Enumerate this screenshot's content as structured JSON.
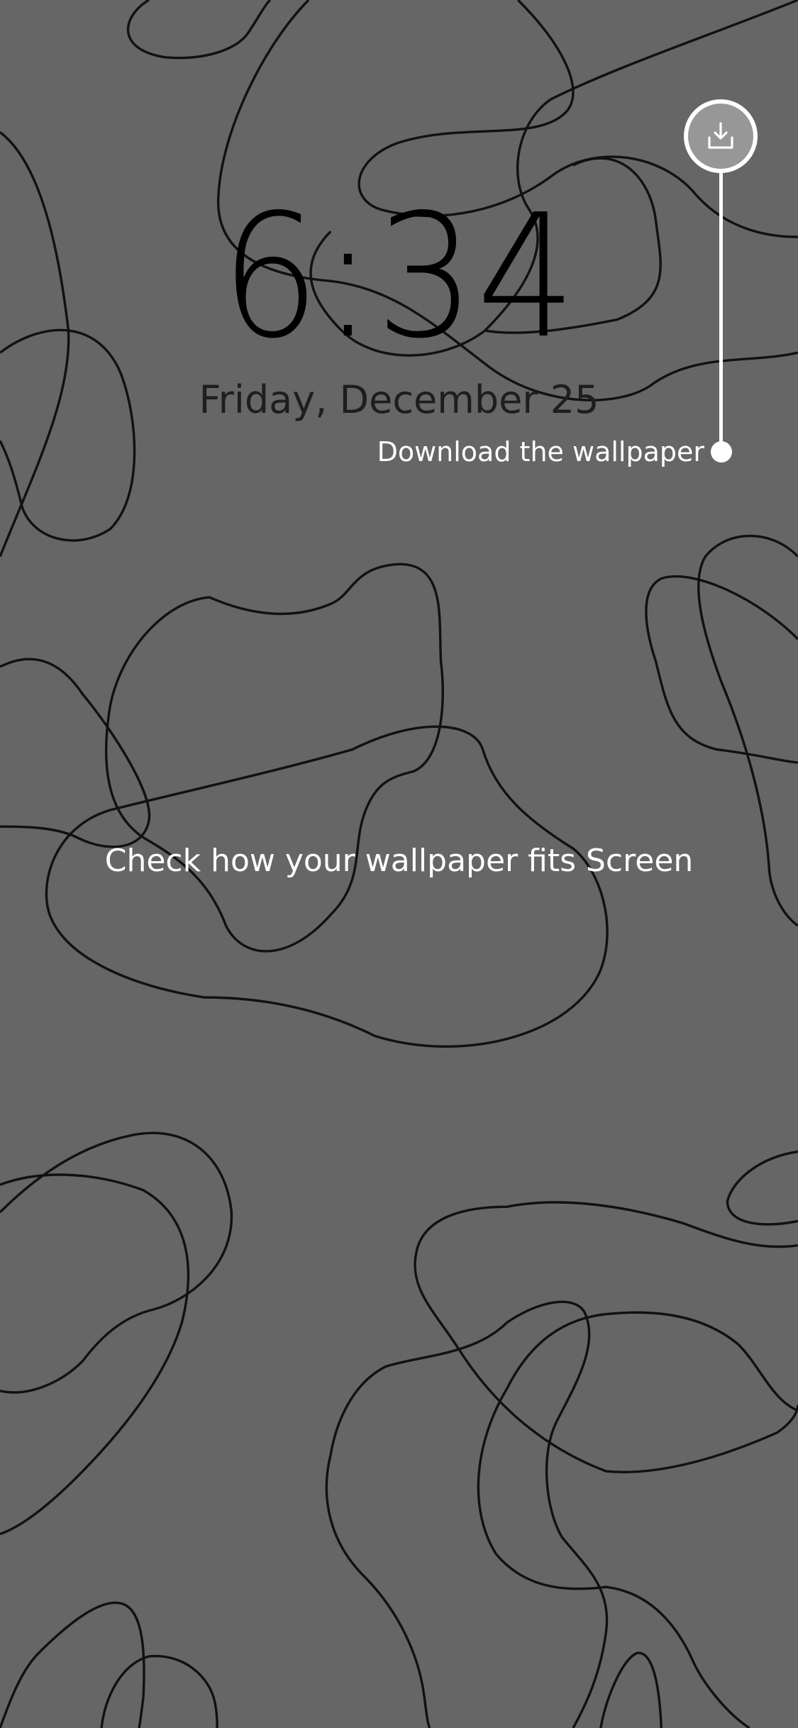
{
  "lockscreen": {
    "time": "6:34",
    "date": "Friday, December 25"
  },
  "download": {
    "icon": "download-icon",
    "label": "Download the wallpaper"
  },
  "preview": {
    "message": "Check how your wallpaper fits Screen"
  },
  "colors": {
    "background": "#666666",
    "line_art": "#111111",
    "overlay_text": "#ffffff"
  }
}
